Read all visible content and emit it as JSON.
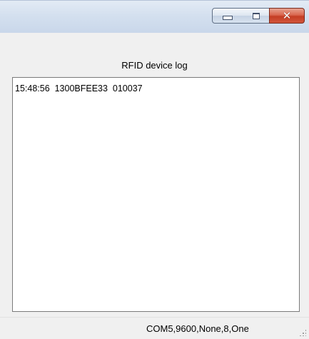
{
  "window": {
    "title": "",
    "controls": {
      "minimize_icon": "minimize-icon",
      "maximize_icon": "maximize-icon",
      "close_glyph": "✕",
      "close_color": "#c43d24"
    }
  },
  "log": {
    "label": "RFID device log",
    "entries": [
      "15:48:56  1300BFEE33  010037"
    ]
  },
  "status": {
    "port_settings": "COM5,9600,None,8,One"
  }
}
